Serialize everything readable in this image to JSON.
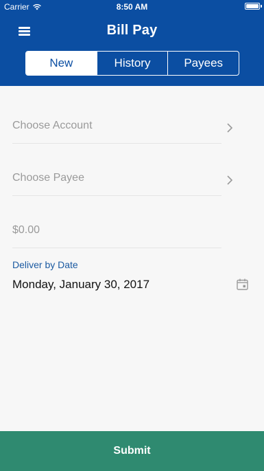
{
  "status_bar": {
    "carrier": "Carrier",
    "time": "8:50 AM"
  },
  "header": {
    "title": "Bill Pay"
  },
  "tabs": [
    {
      "label": "New",
      "active": true
    },
    {
      "label": "History",
      "active": false
    },
    {
      "label": "Payees",
      "active": false
    }
  ],
  "form": {
    "account_placeholder": "Choose Account",
    "payee_placeholder": "Choose Payee",
    "amount_placeholder": "$0.00",
    "deliver_label": "Deliver by Date",
    "deliver_date": "Monday, January 30, 2017"
  },
  "submit_label": "Submit",
  "icons": {
    "menu": "hamburger-menu-icon",
    "chevron": "chevron-right-icon",
    "calendar": "calendar-icon",
    "wifi": "wifi-icon",
    "battery": "battery-icon"
  },
  "colors": {
    "header": "#0b4ea2",
    "accent_text": "#1b5aa1",
    "submit": "#2f8a70",
    "background": "#f7f7f7"
  }
}
